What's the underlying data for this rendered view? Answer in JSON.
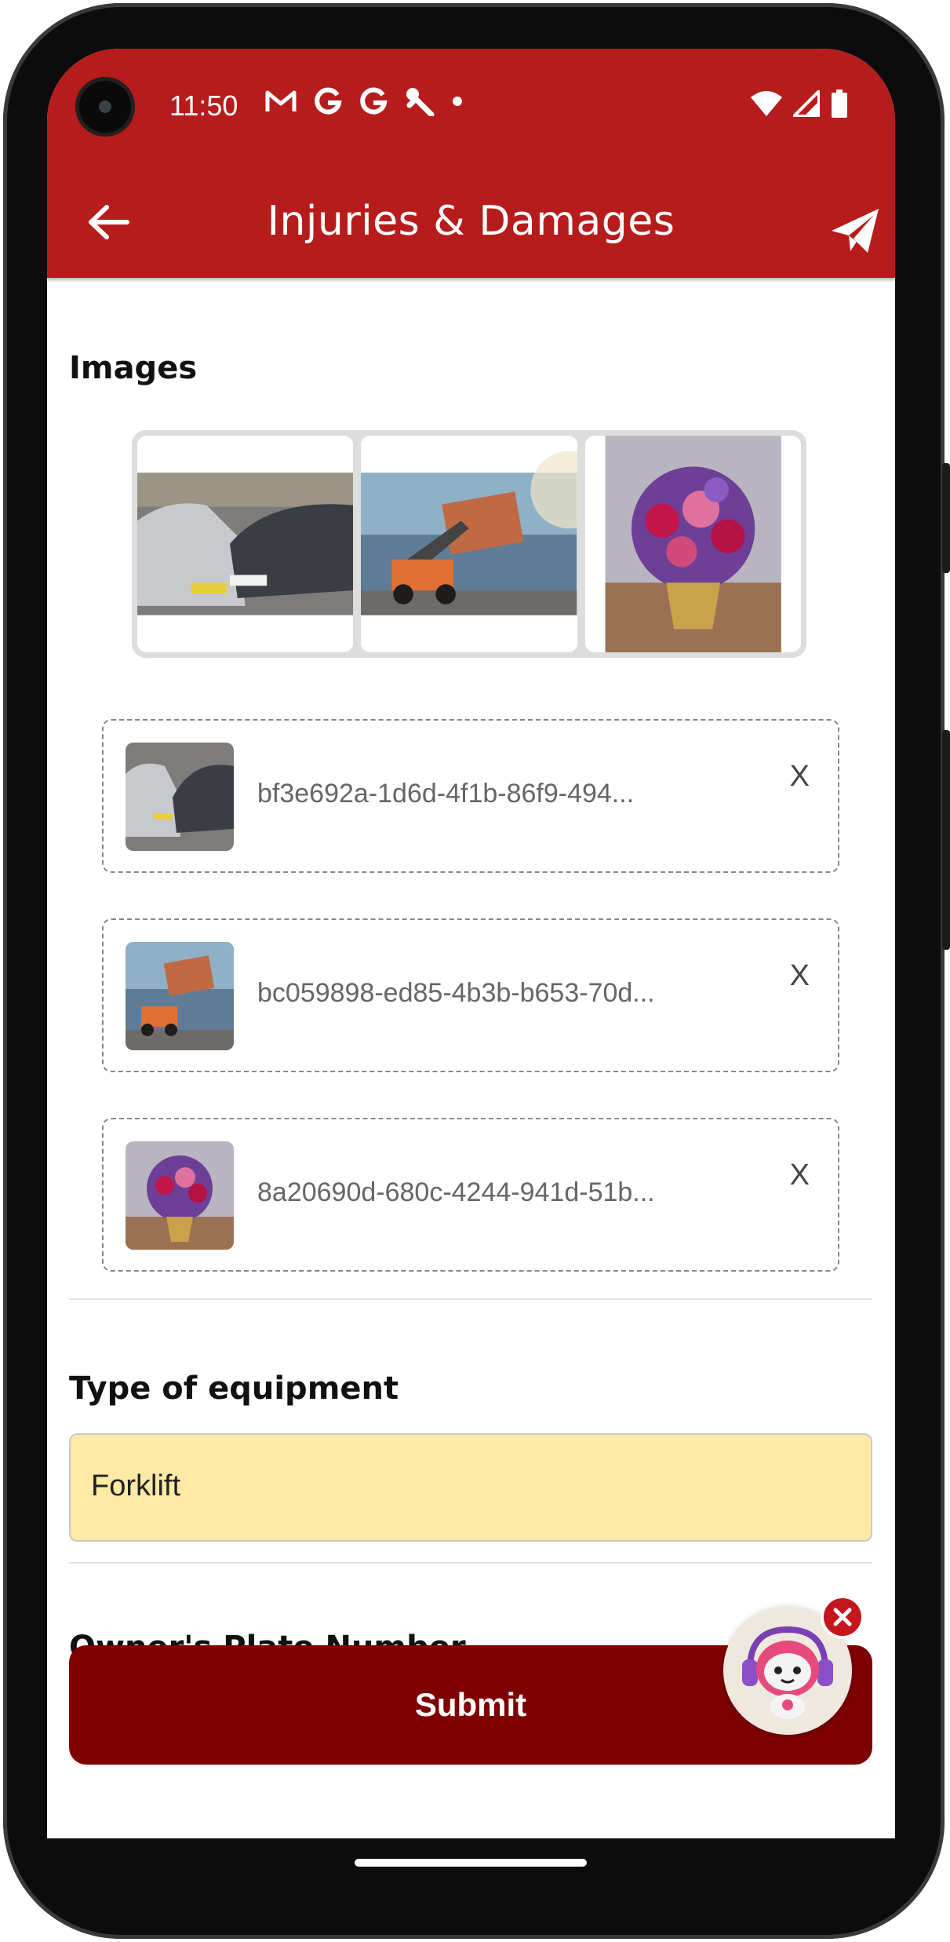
{
  "status_bar": {
    "time": "11:50",
    "notification_icons": [
      "gmail-icon",
      "google-icon",
      "google-icon",
      "wrench-icon",
      "dot-icon"
    ],
    "system_icons": [
      "wifi-icon",
      "signal-icon",
      "battery-icon"
    ]
  },
  "app_bar": {
    "title": "Injuries & Damages",
    "back_icon": "arrow-left-icon",
    "send_icon": "paper-plane-icon"
  },
  "images_section": {
    "label": "Images",
    "gallery": [
      "car-crash-photo",
      "forklift-container-photo",
      "flower-bouquet-photo"
    ],
    "files": [
      {
        "name": "bf3e692a-1d6d-4f1b-86f9-494...",
        "thumb": "car-crash-photo",
        "remove": "X"
      },
      {
        "name": "bc059898-ed85-4b3b-b653-70d...",
        "thumb": "forklift-container-photo",
        "remove": "X"
      },
      {
        "name": "8a20690d-680c-4244-941d-51b...",
        "thumb": "flower-bouquet-photo",
        "remove": "X"
      }
    ]
  },
  "equipment": {
    "label": "Type of equipment",
    "value": "Forklift"
  },
  "owner_plate": {
    "label": "Owner's Plate Number"
  },
  "submit": {
    "label": "Submit"
  },
  "colors": {
    "primary": "#b71c1c",
    "submit": "#7f0000",
    "field_bg": "#ffe9a6"
  }
}
